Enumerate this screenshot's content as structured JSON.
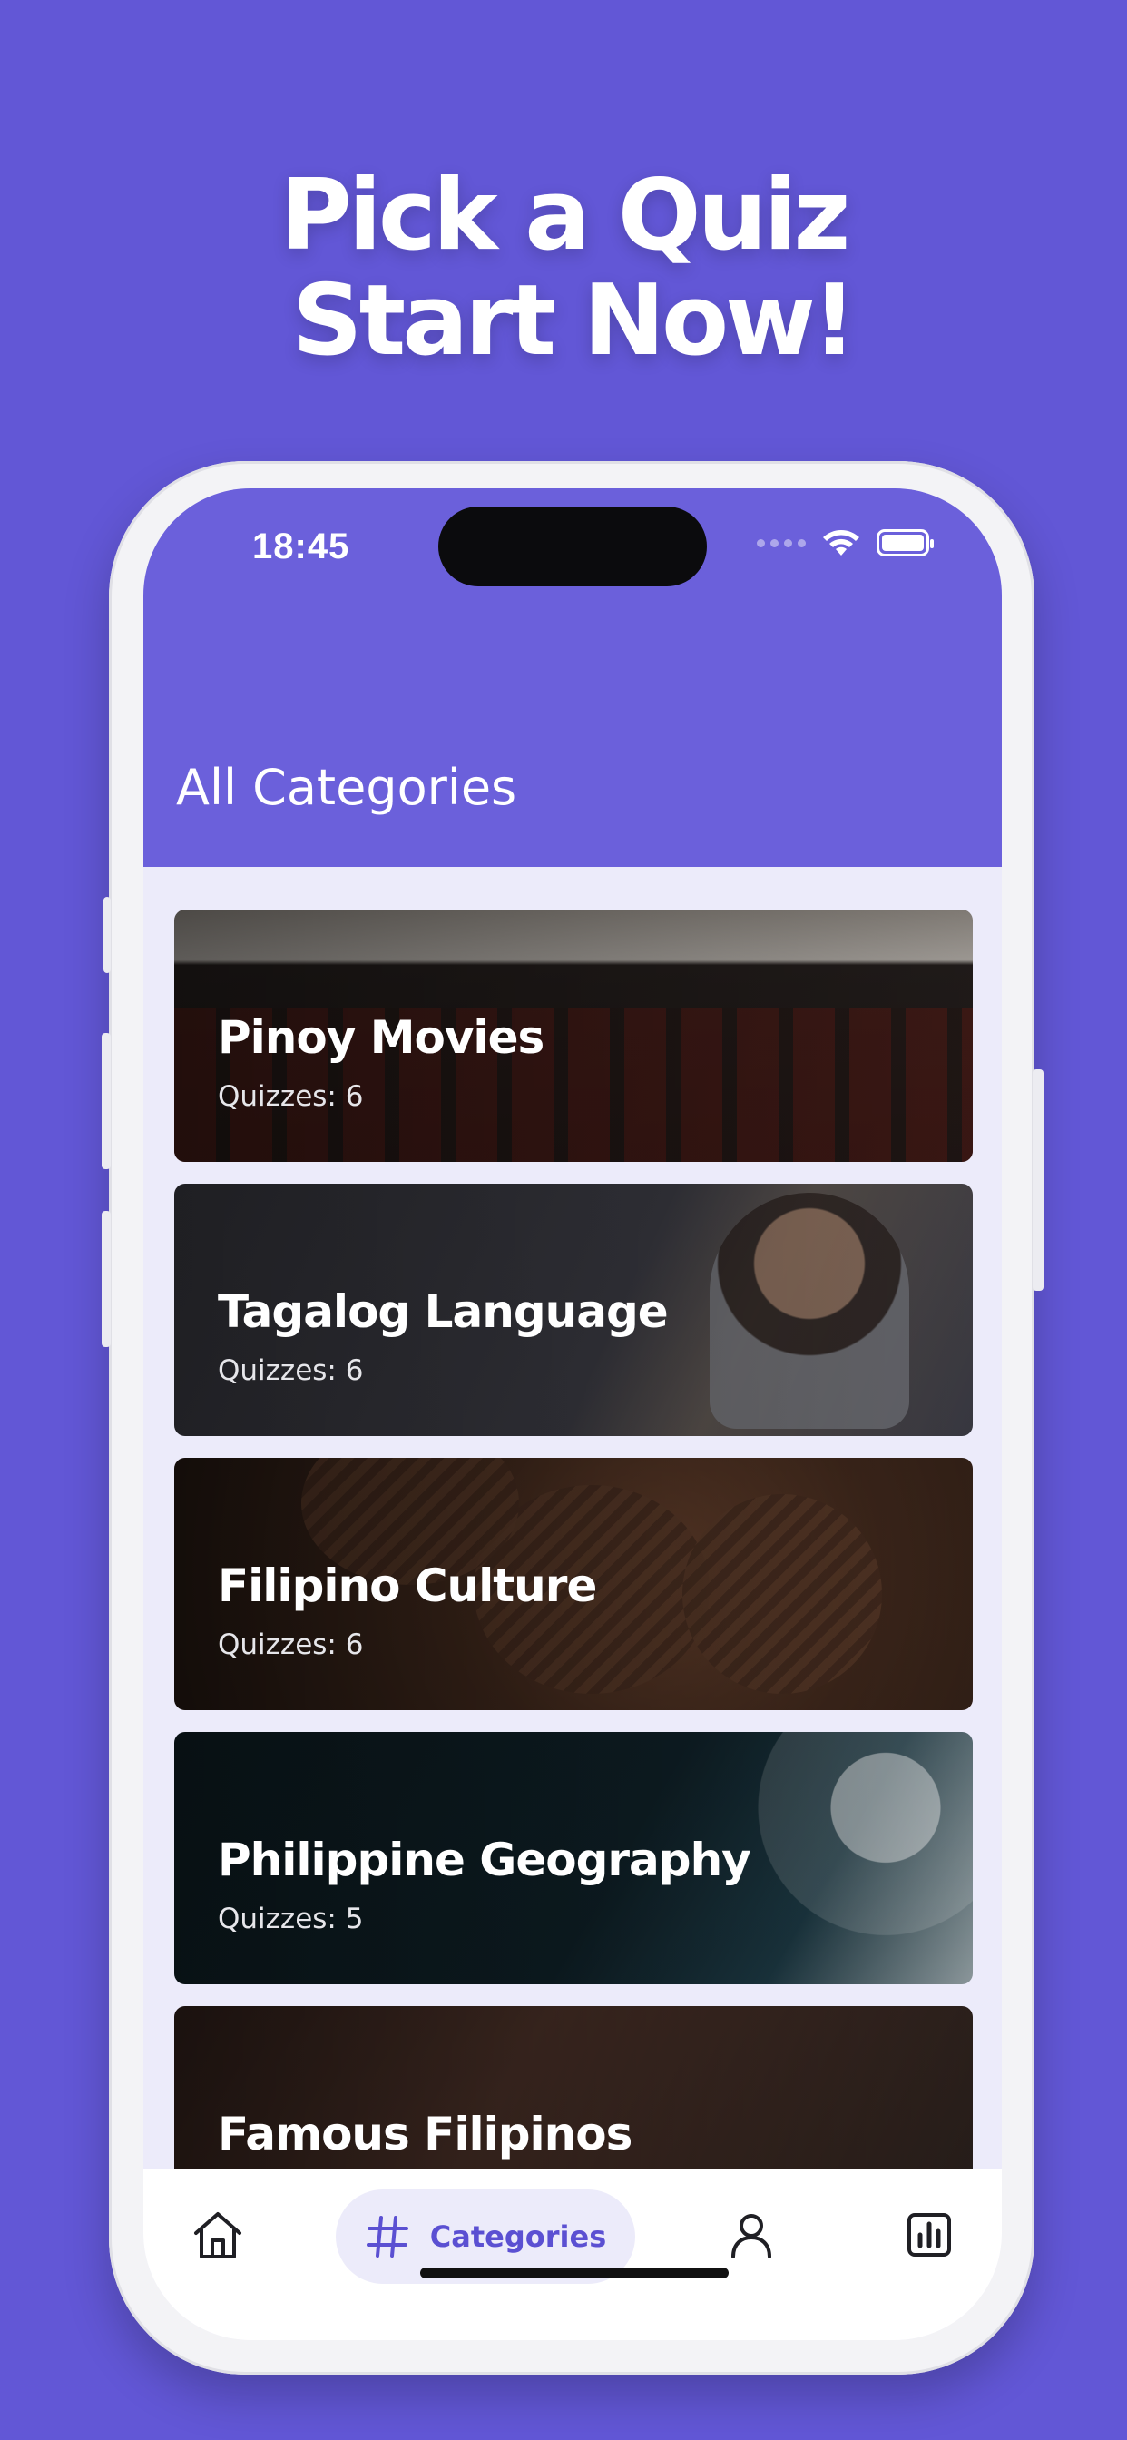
{
  "promo": {
    "line1": "Pick a Quiz",
    "line2": "Start Now!"
  },
  "status_bar": {
    "time": "18:45",
    "icons": [
      "signal-dots-icon",
      "wifi-icon",
      "battery-icon"
    ]
  },
  "header": {
    "title": "All Categories"
  },
  "categories": [
    {
      "title": "Pinoy Movies",
      "count_text": "Quizzes: 6"
    },
    {
      "title": "Tagalog Language",
      "count_text": "Quizzes: 6"
    },
    {
      "title": "Filipino Culture",
      "count_text": "Quizzes: 6"
    },
    {
      "title": "Philippine Geography",
      "count_text": "Quizzes: 5"
    },
    {
      "title": "Famous Filipinos",
      "count_text": ""
    }
  ],
  "tabbar": {
    "items": [
      {
        "icon": "home-icon",
        "label": ""
      },
      {
        "icon": "hashtag-icon",
        "label": "Categories",
        "active": true
      },
      {
        "icon": "person-icon",
        "label": ""
      },
      {
        "icon": "bar-chart-icon",
        "label": ""
      }
    ]
  },
  "colors": {
    "background": "#6257d6",
    "header": "#6b60db",
    "list_background": "#ecebfa",
    "accent": "#5b50d2"
  }
}
